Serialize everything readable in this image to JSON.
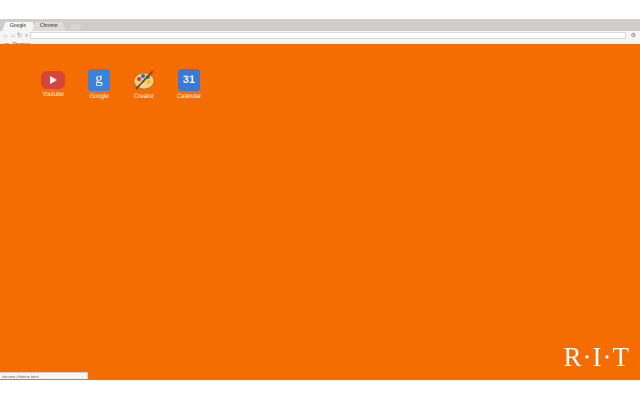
{
  "tabs": [
    {
      "label": "Google"
    },
    {
      "label": "Chrome"
    }
  ],
  "toolbar": {
    "back_icon": "←",
    "forward_icon": "→",
    "reload_icon": "↻",
    "search_icon": "⌕",
    "settings_icon": "⚙"
  },
  "bookmarks": {
    "item_label": "Themes"
  },
  "apps": [
    {
      "label": "Youtube"
    },
    {
      "label": "Google",
      "icon_glyph": "g"
    },
    {
      "label": "Creator"
    },
    {
      "label": "Calendar",
      "icon_glyph": "31"
    }
  ],
  "status": {
    "url": "chrome://theme.html"
  },
  "theme": {
    "content_color": "#f56d00",
    "logo_text": "R·I·T"
  }
}
